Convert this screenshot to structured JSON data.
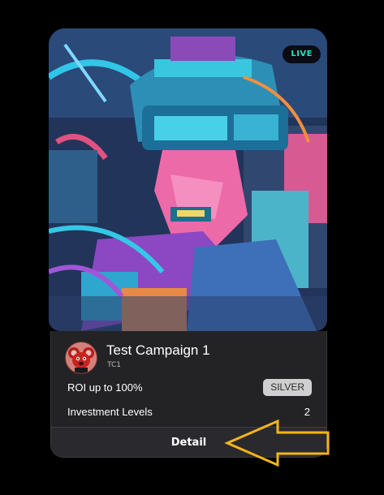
{
  "campaign": {
    "status_badge": "LIVE",
    "title": "Test Campaign 1",
    "symbol": "TC1",
    "roi_text": "ROI up to 100%",
    "tier_badge": "SILVER",
    "levels_label": "Investment Levels",
    "levels_value": "2",
    "detail_label": "Detail"
  },
  "colors": {
    "page_background": "#000000",
    "card_background": "#232326",
    "live_text": "#1ee6c0",
    "tier_badge_bg": "#cfcfcf",
    "annotation_arrow": "#f3b51b"
  },
  "icons": {
    "avatar": "red-koala-avatar",
    "annotation": "left-arrow-outline-icon"
  }
}
